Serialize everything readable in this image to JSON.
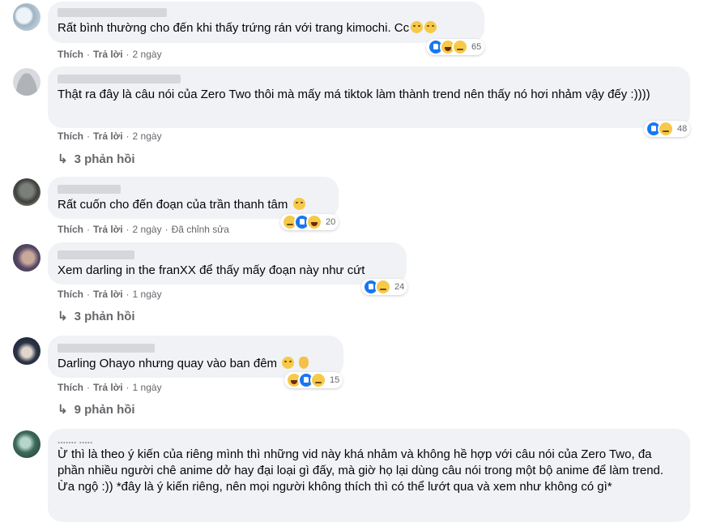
{
  "actions": {
    "like": "Thích",
    "reply": "Trả lời",
    "sep": "·"
  },
  "comments": [
    {
      "text": "Rất bình thường cho đến khi thấy trứng rán với trang kimochi. Cc",
      "emojis": [
        "pensive-face-emoji",
        "pensive-face-emoji"
      ],
      "time": "2 ngày",
      "reaction_count": "65",
      "reactions": [
        "like",
        "haha",
        "sad"
      ]
    },
    {
      "text": "Thật ra đây là câu nói của Zero Two thôi mà mấy má tiktok làm thành trend nên thấy nó hơi nhảm vậy đếy :))))",
      "time": "2 ngày",
      "reaction_count": "48",
      "reactions": [
        "like",
        "sad"
      ],
      "replies": "3 phản hồi"
    },
    {
      "text": "Rất cuốn cho đến đoạn của trần thanh tâm",
      "emojis": [
        "worried-face-emoji"
      ],
      "time": "2 ngày",
      "edited": "Đã chỉnh sửa",
      "reaction_count": "20",
      "reactions": [
        "sad",
        "like",
        "haha"
      ]
    },
    {
      "text": "Xem darling in the franXX để thấy mấy đoạn này như cứt",
      "time": "1 ngày",
      "reaction_count": "24",
      "reactions": [
        "like",
        "sad"
      ],
      "replies": "3 phản hồi"
    },
    {
      "text": "Darling Ohayo nhưng quay vào ban đêm",
      "emojis": [
        "smirk-face-emoji",
        "ok-hand-emoji"
      ],
      "time": "1 ngày",
      "reaction_count": "15",
      "reactions": [
        "haha",
        "like",
        "sad"
      ],
      "replies": "9 phản hồi"
    },
    {
      "name": "....... .....",
      "text": "Ừ thì là theo ý kiến của riêng mình thì những vid này khá nhảm và không hề hợp với câu nói của Zero Two, đa phần nhiều người chê anime dở hay đại loại gì đấy, mà giờ họ lại dùng câu nói trong một bộ anime để làm trend. Ừa ngộ :)) *đây là ý kiến riêng, nên mọi người không thích thì có thể lướt qua và xem như không có gì*"
    }
  ]
}
